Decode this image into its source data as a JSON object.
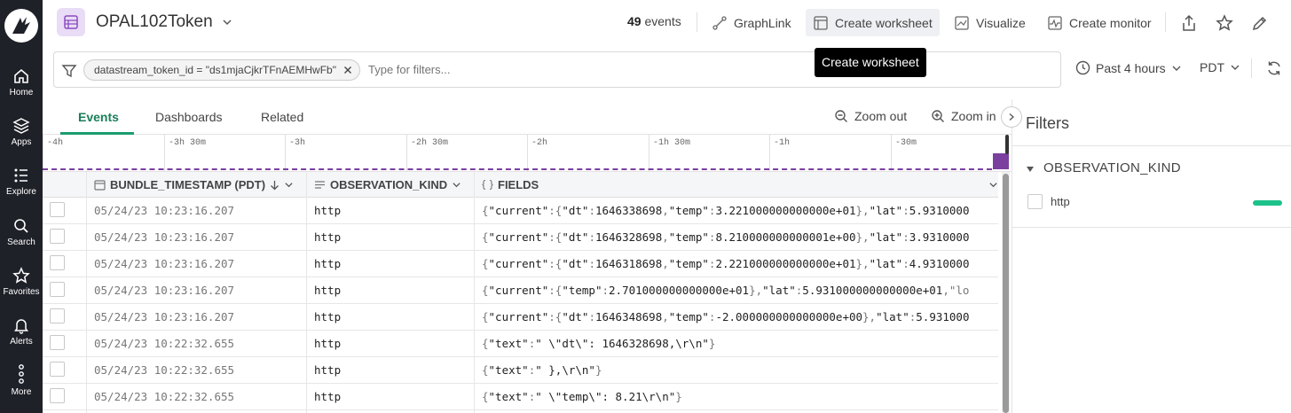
{
  "sidebar": {
    "items": [
      {
        "label": "Home",
        "icon": "home-icon"
      },
      {
        "label": "Apps",
        "icon": "apps-icon"
      },
      {
        "label": "Explore",
        "icon": "explore-icon"
      },
      {
        "label": "Search",
        "icon": "search-icon"
      },
      {
        "label": "Favorites",
        "icon": "star-icon"
      },
      {
        "label": "Alerts",
        "icon": "bell-icon"
      },
      {
        "label": "More",
        "icon": "more-icon"
      }
    ]
  },
  "header": {
    "title": "OPAL102Token",
    "event_count": "49",
    "event_label": "events",
    "actions": {
      "graphlink": "GraphLink",
      "create_worksheet": "Create worksheet",
      "visualize": "Visualize",
      "create_monitor": "Create monitor"
    },
    "tooltip": "Create worksheet"
  },
  "filter": {
    "chip": "datastream_token_id = \"ds1mjaCjkrTFnAEMHwFb\"",
    "placeholder": "Type for filters..."
  },
  "time": {
    "range": "Past 4 hours",
    "timezone": "PDT"
  },
  "tabs": [
    "Events",
    "Dashboards",
    "Related"
  ],
  "zoom": {
    "out": "Zoom out",
    "in": "Zoom in"
  },
  "timeline": {
    "ticks": [
      "-4h",
      "-3h 30m",
      "-3h",
      "-2h 30m",
      "-2h",
      "-1h 30m",
      "-1h",
      "-30m"
    ]
  },
  "table": {
    "columns": [
      "BUNDLE_TIMESTAMP (PDT)",
      "OBSERVATION_KIND",
      "FIELDS"
    ],
    "rows": [
      {
        "ts": "05/24/23 10:23:16.207",
        "kind": "http",
        "fields": "{\"current\":{\"dt\":1646338698,\"temp\":3.221000000000000e+01},\"lat\":5.9310000"
      },
      {
        "ts": "05/24/23 10:23:16.207",
        "kind": "http",
        "fields": "{\"current\":{\"dt\":1646328698,\"temp\":8.210000000000001e+00},\"lat\":3.9310000"
      },
      {
        "ts": "05/24/23 10:23:16.207",
        "kind": "http",
        "fields": "{\"current\":{\"dt\":1646318698,\"temp\":2.221000000000000e+01},\"lat\":4.9310000"
      },
      {
        "ts": "05/24/23 10:23:16.207",
        "kind": "http",
        "fields": "{\"current\":{\"temp\":2.701000000000000e+01},\"lat\":5.931000000000000e+01,\"lo"
      },
      {
        "ts": "05/24/23 10:23:16.207",
        "kind": "http",
        "fields": "{\"current\":{\"dt\":1646348698,\"temp\":-2.000000000000000e+00},\"lat\":5.931000"
      },
      {
        "ts": "05/24/23 10:22:32.655",
        "kind": "http",
        "fields": "{\"text\":\" \\\"dt\\\": 1646328698,\\r\\n\"}"
      },
      {
        "ts": "05/24/23 10:22:32.655",
        "kind": "http",
        "fields": "{\"text\":\" },\\r\\n\"}"
      },
      {
        "ts": "05/24/23 10:22:32.655",
        "kind": "http",
        "fields": "{\"text\":\" \\\"temp\\\": 8.21\\r\\n\"}"
      }
    ]
  },
  "filters_panel": {
    "title": "Filters",
    "group": "OBSERVATION_KIND",
    "options": [
      {
        "label": "http",
        "share": 1.0
      }
    ]
  },
  "colors": {
    "accent": "#1a9e6e",
    "purple": "#7b3fa0",
    "sidebar": "#1f2129"
  }
}
